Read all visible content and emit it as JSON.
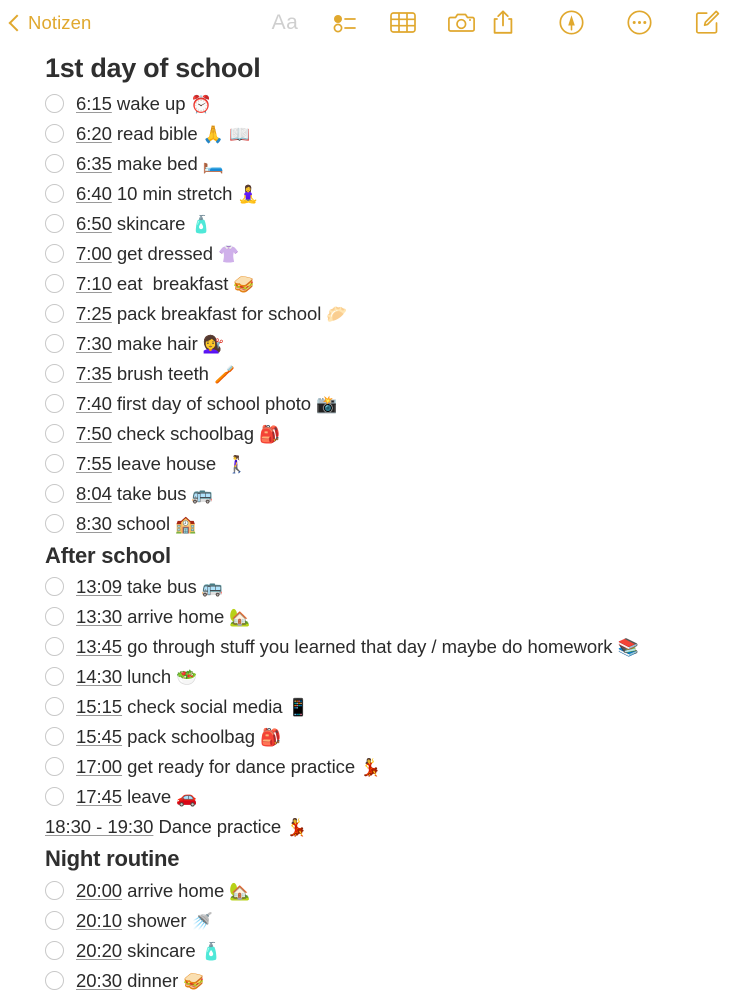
{
  "toolbar": {
    "back_label": "Notizen",
    "back_icon": "chevron-left-icon",
    "format_label": "Aa",
    "icons": [
      {
        "name": "checklist-icon",
        "label": "Checklist"
      },
      {
        "name": "table-icon",
        "label": "Table"
      },
      {
        "name": "camera-icon",
        "label": "Camera"
      },
      {
        "name": "share-icon",
        "label": "Share"
      },
      {
        "name": "markup-pen-icon",
        "label": "Markup"
      },
      {
        "name": "more-options-icon",
        "label": "More"
      },
      {
        "name": "compose-icon",
        "label": "New Note"
      }
    ],
    "accent_color": "#E0A82E",
    "disabled_color": "#CFCFCF"
  },
  "note": {
    "title": "1st day of school",
    "blocks": [
      {
        "type": "checklist",
        "items": [
          {
            "time": "6:15",
            "text": " wake up ",
            "emoji": "⏰"
          },
          {
            "time": "6:20",
            "text": " read bible ",
            "emoji": "🙏 📖"
          },
          {
            "time": "6:35",
            "text": " make bed ",
            "emoji": "🛏️"
          },
          {
            "time": "6:40",
            "text": " 10 min stretch ",
            "emoji": "🧘‍♀️"
          },
          {
            "time": "6:50",
            "text": " skincare ",
            "emoji": "🧴"
          },
          {
            "time": "7:00",
            "text": " get dressed ",
            "emoji": "👚"
          },
          {
            "time": "7:10",
            "text": " eat  breakfast ",
            "emoji": "🥪"
          },
          {
            "time": "7:25",
            "text": " pack breakfast for school ",
            "emoji": "🥟"
          },
          {
            "time": "7:30",
            "text": " make hair ",
            "emoji": "💇‍♀️"
          },
          {
            "time": "7:35",
            "text": " brush teeth ",
            "emoji": "🪥"
          },
          {
            "time": "7:40",
            "text": " first day of school photo ",
            "emoji": "📸"
          },
          {
            "time": "7:50",
            "text": " check schoolbag ",
            "emoji": "🎒"
          },
          {
            "time": "7:55",
            "text": " leave house  ",
            "emoji": "🚶‍♀️"
          },
          {
            "time": "8:04",
            "text": " take bus ",
            "emoji": "🚌"
          },
          {
            "time": "8:30",
            "text": " school ",
            "emoji": "🏫"
          }
        ]
      },
      {
        "type": "heading",
        "text": "After school"
      },
      {
        "type": "checklist",
        "items": [
          {
            "time": "13:09",
            "text": " take bus ",
            "emoji": "🚌"
          },
          {
            "time": "13:30",
            "text": " arrive home ",
            "emoji": "🏡"
          },
          {
            "time": "13:45",
            "text": " go through stuff you learned that day / maybe do homework ",
            "emoji": "📚"
          },
          {
            "time": "14:30",
            "text": " lunch ",
            "emoji": "🥗"
          },
          {
            "time": "15:15",
            "text": " check social media ",
            "emoji": "📱"
          },
          {
            "time": "15:45",
            "text": " pack schoolbag ",
            "emoji": "🎒"
          },
          {
            "time": "17:00",
            "text": " get ready for dance practice ",
            "emoji": "💃"
          },
          {
            "time": "17:45",
            "text": " leave ",
            "emoji": "🚗"
          }
        ]
      },
      {
        "type": "plain",
        "time": "18:30 - 19:30",
        "text": " Dance practice ",
        "emoji": "💃"
      },
      {
        "type": "heading",
        "text": "Night routine"
      },
      {
        "type": "checklist",
        "items": [
          {
            "time": "20:00",
            "text": " arrive home ",
            "emoji": "🏡"
          },
          {
            "time": "20:10",
            "text": " shower ",
            "emoji": "🚿"
          },
          {
            "time": "20:20",
            "text": " skincare ",
            "emoji": "🧴"
          },
          {
            "time": "20:30",
            "text": " dinner ",
            "emoji": "🥪"
          }
        ]
      }
    ]
  }
}
